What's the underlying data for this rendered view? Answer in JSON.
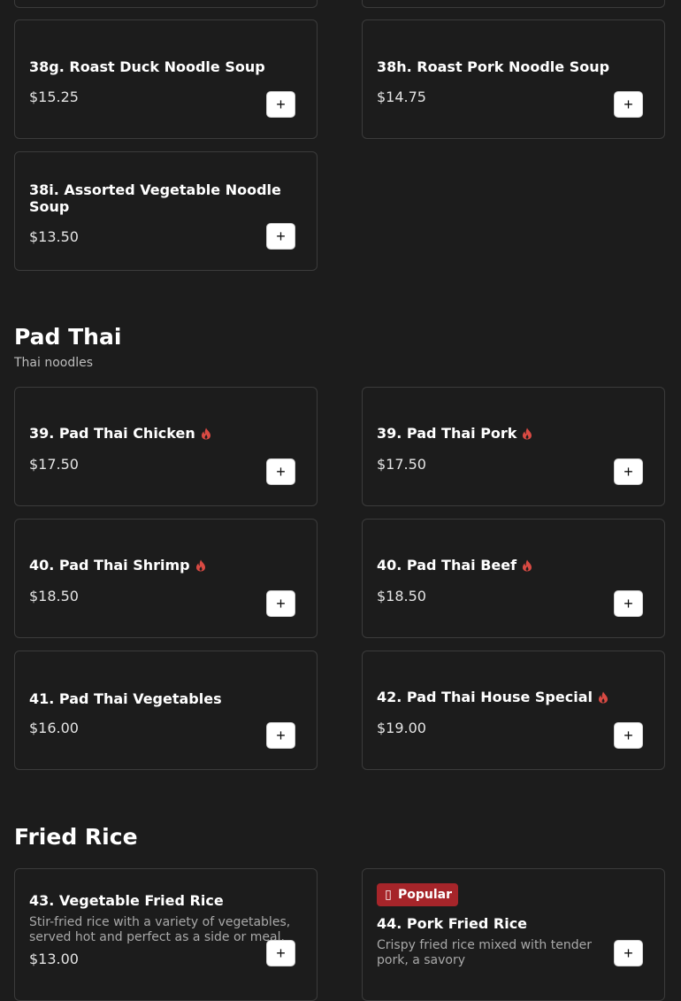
{
  "partial_cards": [
    "",
    ""
  ],
  "noodle_soup_items": [
    {
      "name": "38g. Roast Duck Noodle Soup",
      "price": "$15.25",
      "add": "+"
    },
    {
      "name": "38h. Roast Pork Noodle Soup",
      "price": "$14.75",
      "add": "+"
    },
    {
      "name": "38i. Assorted Vegetable Noodle Soup",
      "price": "$13.50",
      "add": "+"
    }
  ],
  "pad_thai": {
    "title": "Pad Thai",
    "subtitle": "Thai noodles",
    "items": [
      {
        "name": "39. Pad Thai Chicken",
        "price": "$17.50",
        "add": "+",
        "spicy": true
      },
      {
        "name": "39. Pad Thai Pork",
        "price": "$17.50",
        "add": "+",
        "spicy": true
      },
      {
        "name": "40. Pad Thai Shrimp",
        "price": "$18.50",
        "add": "+",
        "spicy": true
      },
      {
        "name": "40. Pad Thai Beef",
        "price": "$18.50",
        "add": "+",
        "spicy": true
      },
      {
        "name": "41. Pad Thai Vegetables",
        "price": "$16.00",
        "add": "+",
        "spicy": false
      },
      {
        "name": "42. Pad Thai House Special",
        "price": "$19.00",
        "add": "+",
        "spicy": true
      }
    ]
  },
  "fried_rice": {
    "title": "Fried Rice",
    "items": [
      {
        "name": "43. Vegetable Fried Rice",
        "description": "Stir-fried rice with a variety of vegetables, served hot and perfect as a side or meal.",
        "price": "$13.00",
        "add": "+"
      },
      {
        "badge": "Popular",
        "name": "44. Pork Fried Rice",
        "description": "Crispy fried rice mixed with tender pork, a savory",
        "add": "+"
      }
    ]
  },
  "icons": {
    "spicy": "flame-icon",
    "add": "plus-icon",
    "badge": "fire-icon"
  },
  "colors": {
    "background": "#1c1c1c",
    "card_border": "#3b3b3b",
    "spicy": "#d94a43",
    "badge": "#a6252a"
  }
}
